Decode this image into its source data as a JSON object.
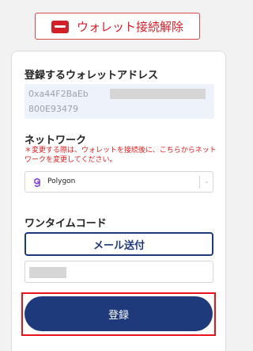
{
  "header": {
    "disconnect_label": "ウォレット接続解除",
    "wallet_icon": "wallet-icon"
  },
  "address": {
    "label": "登録するウォレットアドレス",
    "line1": "0xa44F2BaEb",
    "line2": "800E93479"
  },
  "network": {
    "label": "ネットワーク",
    "note": "＊変更する際は、ウォレットを接続後に、こちらからネットワークを変更してください。",
    "selected": "Polygon",
    "icon": "polygon-icon",
    "accent": "#8247e5"
  },
  "otp": {
    "label": "ワンタイムコード",
    "send_label": "メール送付"
  },
  "submit": {
    "label": "登録"
  },
  "colors": {
    "brand": "#1e3a7a",
    "danger": "#d21f2a",
    "highlight": "#e8141a"
  }
}
